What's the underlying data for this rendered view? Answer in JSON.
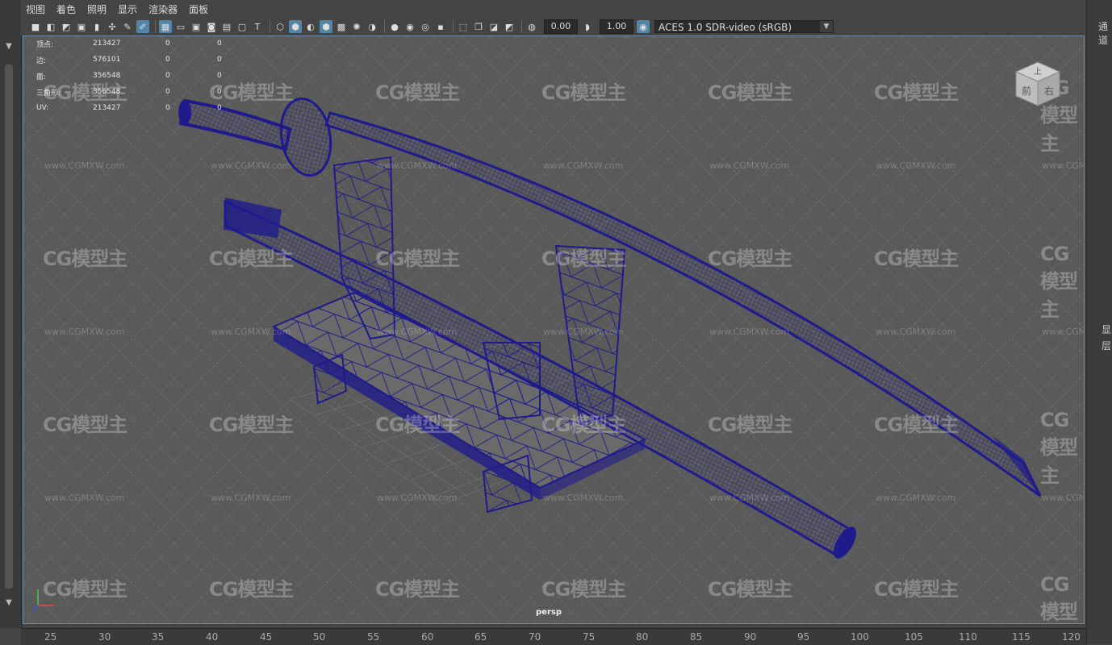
{
  "menu": [
    "视图",
    "着色",
    "照明",
    "显示",
    "渲染器",
    "面板"
  ],
  "toolbar": {
    "exposure": "0.00",
    "gamma": "1.00",
    "colorspace": "ACES 1.0 SDR-video (sRGB)"
  },
  "hud": [
    {
      "label": "顶点:",
      "v1": "213427",
      "v2": "0",
      "v3": "0"
    },
    {
      "label": "边:",
      "v1": "576101",
      "v2": "0",
      "v3": "0"
    },
    {
      "label": "面:",
      "v1": "356548",
      "v2": "0",
      "v3": "0"
    },
    {
      "label": "三角形:",
      "v1": "356548",
      "v2": "0",
      "v3": "0"
    },
    {
      "label": "UV:",
      "v1": "213427",
      "v2": "0",
      "v3": "0"
    }
  ],
  "watermark": {
    "logo": "CG模型主",
    "url": "www.CGMXW.com"
  },
  "viewcube": {
    "top": "上",
    "front": "前",
    "right": "右"
  },
  "camera": "persp",
  "ruler": [
    "25",
    "30",
    "35",
    "40",
    "45",
    "50",
    "55",
    "60",
    "65",
    "70",
    "75",
    "80",
    "85",
    "90",
    "95",
    "100",
    "105",
    "110",
    "115",
    "120"
  ],
  "rightpanel": {
    "top": "通道",
    "mid1": "显",
    "mid2": "层"
  },
  "colors": {
    "wire": "#1f1b8c",
    "bg": "#5a5a5a",
    "accent": "#5285a6"
  }
}
